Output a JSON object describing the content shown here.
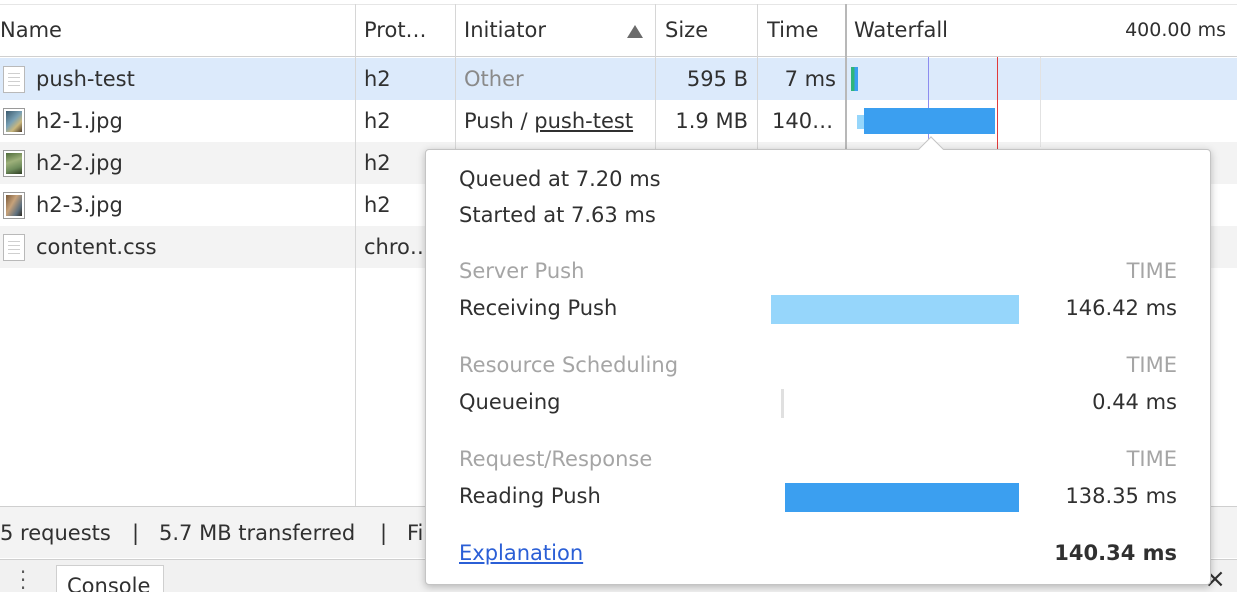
{
  "columns": {
    "name": "Name",
    "protocol": "Prot…",
    "initiator": "Initiator",
    "size": "Size",
    "time": "Time",
    "waterfall": "Waterfall",
    "waterfall_scale": "400.00 ms"
  },
  "rows": [
    {
      "name": "push-test",
      "protocol": "h2",
      "initiator": "Other",
      "size": "595 B",
      "time": "7 ms",
      "icon": "document-icon"
    },
    {
      "name": "h2-1.jpg",
      "protocol": "h2",
      "initiator_prefix": "Push / ",
      "initiator_link": "push-test",
      "size": "1.9 MB",
      "time": "140…",
      "icon": "image-icon"
    },
    {
      "name": "h2-2.jpg",
      "protocol": "h2",
      "icon": "image-icon"
    },
    {
      "name": "h2-3.jpg",
      "protocol": "h2",
      "icon": "image-icon"
    },
    {
      "name": "content.css",
      "protocol": "chro…",
      "icon": "document-icon"
    }
  ],
  "status_bar": {
    "requests": "5 requests",
    "sep1": "|",
    "transferred": "5.7 MB transferred",
    "sep2": "|",
    "finish": "Fi"
  },
  "drawer": {
    "console_tab": "Console",
    "close": "×"
  },
  "timing_popover": {
    "queued": "Queued at 7.20 ms",
    "started": "Started at 7.63 ms",
    "sections": [
      {
        "title": "Server Push",
        "time_header": "TIME",
        "label": "Receiving Push",
        "value": "146.42 ms"
      },
      {
        "title": "Resource Scheduling",
        "time_header": "TIME",
        "label": "Queueing",
        "value": "0.44 ms"
      },
      {
        "title": "Request/Response",
        "time_header": "TIME",
        "label": "Reading Push",
        "value": "138.35 ms"
      }
    ],
    "explanation": "Explanation",
    "total": "140.34 ms"
  },
  "colors": {
    "selected_row": "#dceafb",
    "receiving_push": "#96d6fb",
    "reading_push": "#3b9ff0",
    "waiting_green": "#2fb57a",
    "load_line": "#e03b3b",
    "dom_line": "#8c8cf0",
    "link": "#2b5fd6"
  }
}
